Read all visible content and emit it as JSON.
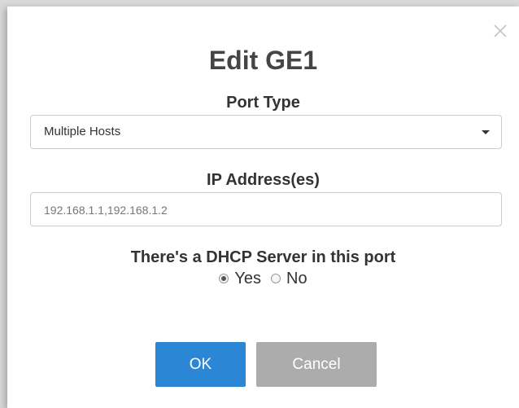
{
  "dialog": {
    "title": "Edit GE1",
    "close_icon": "close-icon"
  },
  "port_type": {
    "label": "Port Type",
    "selected": "Multiple Hosts",
    "caret_icon": "caret-down-icon"
  },
  "ip_address": {
    "label": "IP Address(es)",
    "value": "192.168.1.1,192.168.1.2"
  },
  "dhcp": {
    "label": "There's a DHCP Server in this port",
    "options": [
      {
        "label": "Yes",
        "checked": true
      },
      {
        "label": "No",
        "checked": false
      }
    ]
  },
  "buttons": {
    "ok_label": "OK",
    "cancel_label": "Cancel"
  },
  "colors": {
    "ok_button": "#2c86d6",
    "cancel_button": "#acacac",
    "title_text": "#454545"
  }
}
